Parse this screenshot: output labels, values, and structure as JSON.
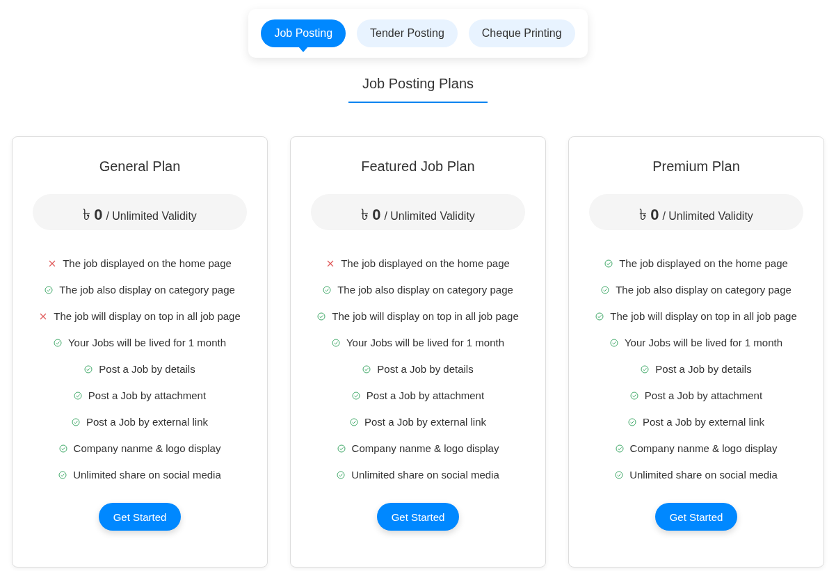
{
  "tabs": [
    {
      "label": "Job Posting",
      "selected": true
    },
    {
      "label": "Tender Posting",
      "selected": false
    },
    {
      "label": "Cheque Printing",
      "selected": false
    }
  ],
  "heading": "Job Posting Plans",
  "plans": [
    {
      "title": "General Plan",
      "currency": "৳",
      "amount": "0",
      "validity": "/ Unlimited Validity",
      "button": "Get Started",
      "features": [
        {
          "text": "The job displayed on the home page",
          "included": false
        },
        {
          "text": "The job also display on category page",
          "included": true
        },
        {
          "text": "The job will display on top in all job page",
          "included": false
        },
        {
          "text": "Your Jobs will be lived for 1 month",
          "included": true
        },
        {
          "text": "Post a Job by details",
          "included": true
        },
        {
          "text": "Post a Job by attachment",
          "included": true
        },
        {
          "text": "Post a Job by external link",
          "included": true
        },
        {
          "text": "Company nanme & logo display",
          "included": true
        },
        {
          "text": "Unlimited share on social media",
          "included": true
        }
      ]
    },
    {
      "title": "Featured Job Plan",
      "currency": "৳",
      "amount": "0",
      "validity": "/ Unlimited Validity",
      "button": "Get Started",
      "features": [
        {
          "text": "The job displayed on the home page",
          "included": false
        },
        {
          "text": "The job also display on category page",
          "included": true
        },
        {
          "text": "The job will display on top in all job page",
          "included": true
        },
        {
          "text": "Your Jobs will be lived for 1 month",
          "included": true
        },
        {
          "text": "Post a Job by details",
          "included": true
        },
        {
          "text": "Post a Job by attachment",
          "included": true
        },
        {
          "text": "Post a Job by external link",
          "included": true
        },
        {
          "text": "Company nanme & logo display",
          "included": true
        },
        {
          "text": "Unlimited share on social media",
          "included": true
        }
      ]
    },
    {
      "title": "Premium Plan",
      "currency": "৳",
      "amount": "0",
      "validity": "/ Unlimited Validity",
      "button": "Get Started",
      "features": [
        {
          "text": "The job displayed on the home page",
          "included": true
        },
        {
          "text": "The job also display on category page",
          "included": true
        },
        {
          "text": "The job will display on top in all job page",
          "included": true
        },
        {
          "text": "Your Jobs will be lived for 1 month",
          "included": true
        },
        {
          "text": "Post a Job by details",
          "included": true
        },
        {
          "text": "Post a Job by attachment",
          "included": true
        },
        {
          "text": "Post a Job by external link",
          "included": true
        },
        {
          "text": "Company nanme & logo display",
          "included": true
        },
        {
          "text": "Unlimited share on social media",
          "included": true
        }
      ]
    }
  ]
}
